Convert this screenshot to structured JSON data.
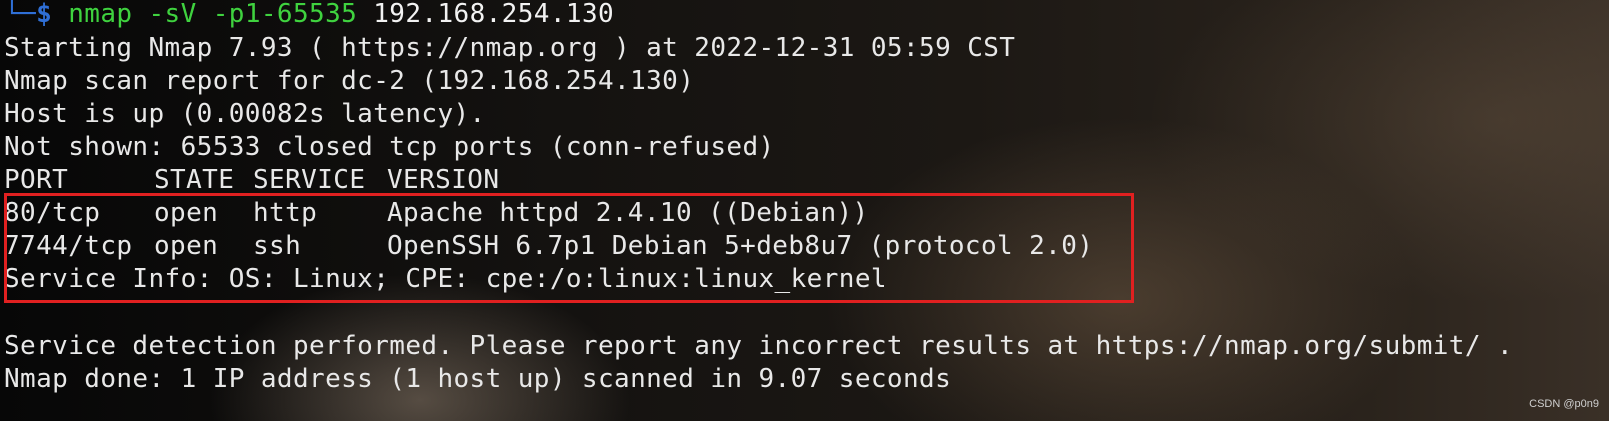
{
  "prompt": {
    "corner": "└─",
    "dollar": "$",
    "command": "nmap",
    "args": " -sV -p1-65535",
    "target": " 192.168.254.130"
  },
  "output": {
    "starting": "Starting Nmap 7.93 ( https://nmap.org ) at 2022-12-31 05:59 CST",
    "report": "Nmap scan report for dc-2 (192.168.254.130)",
    "host_up": "Host is up (0.00082s latency).",
    "not_shown": "Not shown: 65533 closed tcp ports (conn-refused)",
    "headers": [
      "PORT",
      "STATE",
      "SERVICE",
      "VERSION"
    ],
    "rows": [
      {
        "port": "80/tcp",
        "state": "open",
        "service": "http",
        "version": "Apache httpd 2.4.10 ((Debian))"
      },
      {
        "port": "7744/tcp",
        "state": "open",
        "service": "ssh",
        "version": "OpenSSH 6.7p1 Debian 5+deb8u7 (protocol 2.0)"
      }
    ],
    "service_info": "Service Info: OS: Linux; CPE: cpe:/o:linux:linux_kernel",
    "detection": "Service detection performed. Please report any incorrect results at https://nmap.org/submit/ .",
    "done": "Nmap done: 1 IP address (1 host up) scanned in 9.07 seconds"
  },
  "watermark": "CSDN @p0n9",
  "colors": {
    "command": "#3fd23f",
    "prompt": "#2f6fd6",
    "highlight_border": "#e02020",
    "text": "#e8e8e8"
  }
}
